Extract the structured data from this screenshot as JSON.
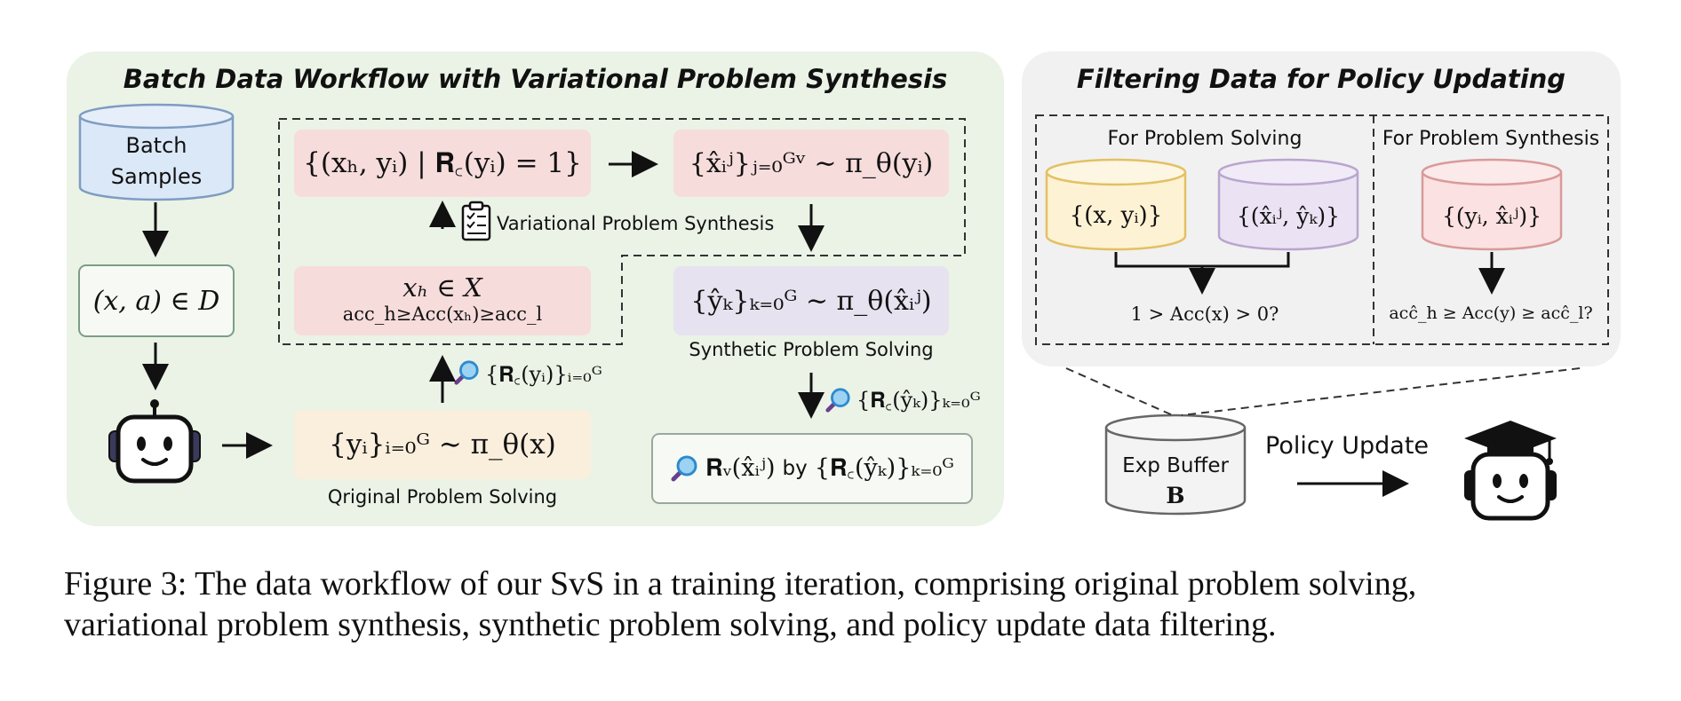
{
  "left_panel": {
    "title": "Batch Data Workflow with Variational Problem Synthesis",
    "batch_db": {
      "line1": "Batch",
      "line2": "Samples"
    },
    "dataset_box": "(x, a) ∈ D",
    "correct_set_box": "{(xₕ, yᵢ) | 𝐑꜀(yᵢ) = 1}",
    "variational_gen_box": "{x̂ᵢʲ}ⱼ₌₀ᴳᵛ ∼ π_θ(yᵢ)",
    "hard_problem_box": {
      "line1": "xₕ ∈ X",
      "line2": "acc_h≥Acc(xₕ)≥acc_l"
    },
    "synthetic_solve_box": "{ŷₖ}ₖ₌₀ᴳ ∼ π_θ(x̂ᵢʲ)",
    "original_solve_box": "{yᵢ}ᵢ₌₀ᴳ ∼ π_θ(x)",
    "verify_box": {
      "main": "𝐑ᵥ(x̂ᵢʲ)",
      "by": "by",
      "tail": "{𝐑꜀(ŷₖ)}ₖ₌₀ᴳ"
    },
    "reward_label_original": "{𝐑꜀(yᵢ)}ᵢ₌₀ᴳ",
    "reward_label_synthetic": "{𝐑꜀(ŷₖ)}ₖ₌₀ᴳ",
    "variational_caption": "Variational Problem Synthesis",
    "synthetic_caption": "Synthetic Problem Solving",
    "original_caption": "Qriginal Problem Solving"
  },
  "right_panel": {
    "title": "Filtering Data for Policy Updating",
    "solving_section": {
      "title": "For Problem Solving",
      "db1": "{(x, yᵢ)}",
      "db2": "{(x̂ᵢʲ, ŷₖ)}",
      "condition": "1 > Acc(x) > 0?"
    },
    "synthesis_section": {
      "title": "For Problem Synthesis",
      "db": "{(yᵢ, x̂ᵢʲ)}",
      "condition": "acĉ_h ≥ Acc(y) ≥ acĉ_l?"
    }
  },
  "buffer": {
    "line1": "Exp Buffer",
    "line2": "B"
  },
  "policy_update_label": "Policy Update",
  "caption": {
    "line1": "Figure 3: The data workflow of our SvS in a training iteration, comprising original problem solving,",
    "line2": "variational problem synthesis, synthetic problem solving, and policy update data filtering."
  },
  "colors": {
    "left_panel_bg": "#eaf3e6",
    "right_panel_bg": "#f1f1f1",
    "pink_box": "#f7dcdc",
    "lavender_box": "#e6e2ef",
    "peach_box": "#faeedd",
    "blue_db": "#dbe8f8",
    "yellow_db": "#fdf2d3",
    "purple_db": "#ebe3f3",
    "red_db": "#fbe1e1"
  },
  "icons": [
    "database-icon",
    "robot-icon",
    "graduate-robot-icon",
    "magnifier-icon",
    "clipboard-icon"
  ]
}
